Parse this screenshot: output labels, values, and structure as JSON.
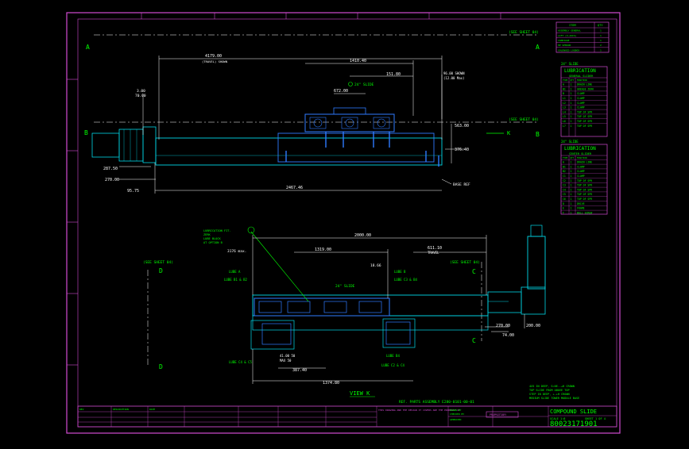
{
  "colors": {
    "frame": "#d24bd2",
    "line": "#ffffff",
    "dim": "#ffffff",
    "accent": "#00ff00",
    "part": "#2f7bff",
    "cyan": "#00d8e8",
    "title": "#d24bd2"
  },
  "sections": {
    "a": "A",
    "b": "B",
    "c": "C",
    "d": "D",
    "k": "K",
    "see_sheet_a": "(SEE SHEET 04)",
    "see_sheet_b": "(SEE SHEET 04)",
    "see_sheet_c": "(SEE SHEET 04)",
    "see_sheet_d": "(SEE SHEET 04)"
  },
  "top_view": {
    "dims": {
      "d1": "4179.00",
      "d1_note": "(TRAVEL) SHOWN",
      "d2": "1410.40",
      "d3": "151.80",
      "d4": "96.00 SHOWN",
      "d4_note": "(12.00 Max)",
      "d5": "672.00",
      "d6": "563.00",
      "d7": "376.40",
      "d8": "287.50",
      "d9": "270.00",
      "d10": "95.75",
      "d11": "2467.46",
      "d12": "3.00",
      "d12_note": "70.00",
      "slide": "24\" SLIDE",
      "base_ref": "BASE REF"
    }
  },
  "bottom_view": {
    "dims": {
      "d1": "2000.00",
      "d2": "1319.00",
      "d3": "611.10",
      "d3_note": "TRAVEL",
      "d4": "3176 max.",
      "d5": "18.66",
      "d6": "387.40",
      "d7": "1374.80",
      "d8": "270.00",
      "d9": "200.00",
      "d10": "74.00",
      "d11": "41.00 50",
      "d11_note": "MAX 50",
      "slide": "24\" SLIDE"
    },
    "lube": {
      "l1": "LUBE A",
      "l2": "LUBE B1 & B2",
      "l3": "LUBE B",
      "l4": "LUBE C3 & B4",
      "l5": "LUBE B4",
      "l6": "LUBE C4 & C5",
      "l7": "LUBE C2 & C4"
    },
    "note_box": {
      "line1": "LUBRICATION FIT.",
      "line2": "ZERK",
      "line3": "LUBE BLOCK",
      "line4": "AT OPTION B"
    },
    "view_label": "VIEW K",
    "ref_note": "REF. PARTS ASSEMBLY E280-0101-00-01",
    "spec_note": {
      "l1": "4X5 IN DEEP, S=0E.-+H CROWN",
      "l2": "TOP SLIDE FROM ABOVE TOP",
      "l3": "STEP IN DEEP, +-+H CROWN",
      "l4": "MEDIUM SLIDE TOWER MODULE BASE"
    }
  },
  "item_table": {
    "header_a": "ITEM",
    "header_b": "QTY",
    "rows": [
      {
        "name": "ASSEMBLY GENERAL",
        "qty": "1"
      },
      {
        "name": "LIFT (X-AXIS)",
        "qty": "1"
      },
      {
        "name": "CARRIAGE",
        "qty": "1"
      },
      {
        "name": "HP SENSOR",
        "qty": "2"
      },
      {
        "name": "SOLENOID LOGBOX",
        "qty": "1"
      }
    ]
  },
  "lube_table_1": {
    "label": "24\" SLIDE",
    "title": "LUBRICATION",
    "subtitle": "GENERAL SLIDER",
    "cols": [
      "TYPE",
      "QTY",
      "FUNCTION"
    ],
    "rows": [
      [
        "A",
        "1",
        "DRAIN LINE"
      ],
      [
        "B1",
        "1",
        "GREASE ZERK"
      ],
      [
        "B",
        "1",
        "CLAMP"
      ],
      [
        "L1",
        "1",
        "CLAMP"
      ],
      [
        "L2",
        "1",
        "CLAMP"
      ],
      [
        "L3",
        "1",
        "CLAMP"
      ],
      [
        "L4",
        "1",
        "TOP OF SPR"
      ],
      [
        "L5",
        "1",
        "TOP OF SPR"
      ],
      [
        "L6",
        "1",
        "TOP OF SPR"
      ],
      [
        "L7",
        "1",
        "TOP OF SPR"
      ]
    ]
  },
  "lube_table_2": {
    "label": "24\" SLIDE",
    "title": "LUBRICATION",
    "subtitle": "CENTER SLIDER",
    "cols": [
      "TYPE",
      "QTY",
      "FUNCTION"
    ],
    "rows": [
      [
        "A",
        "1",
        "DRAIN LINE"
      ],
      [
        "B1",
        "1",
        "CLAMP"
      ],
      [
        "B2",
        "1",
        "CLAMP"
      ],
      [
        "C1",
        "1",
        "CLAMP"
      ],
      [
        "C2",
        "1",
        "TOP OF SPR"
      ],
      [
        "C3",
        "1",
        "TOP OF SPR"
      ],
      [
        "C4",
        "1",
        "TOP OF SPR"
      ],
      [
        "C5",
        "1",
        "TOP OF SPR"
      ],
      [
        "C6",
        "1",
        "TOP OF SPR"
      ],
      [
        "D",
        "1",
        "DRIVE"
      ],
      [
        "E",
        "1",
        "FRAME"
      ],
      [
        "F",
        "1",
        "BALL SCREW"
      ]
    ]
  },
  "title_block": {
    "title": "COMPOUND SLIDE",
    "dwg_no": "80023171901",
    "scale": "SCALE 1:8",
    "sheet": "SHEET 1 OF 4",
    "company": "PROPRIETARY",
    "notes_left": "THIS DRAWING AND THE DESIGN IT COVERS ARE THE PROPERTY OF",
    "drawn": "DRAWN BY",
    "checked": "CHECKED BY",
    "approved": "APPROVED",
    "rev_col": "REV",
    "desc_col": "DESCRIPTION",
    "date_col": "DATE"
  },
  "border": {
    "top_marks": [
      "8",
      "7",
      "6",
      "5",
      "4",
      "3",
      "2",
      "1"
    ],
    "side_marks": [
      "F",
      "E",
      "D",
      "C",
      "B",
      "A"
    ]
  }
}
